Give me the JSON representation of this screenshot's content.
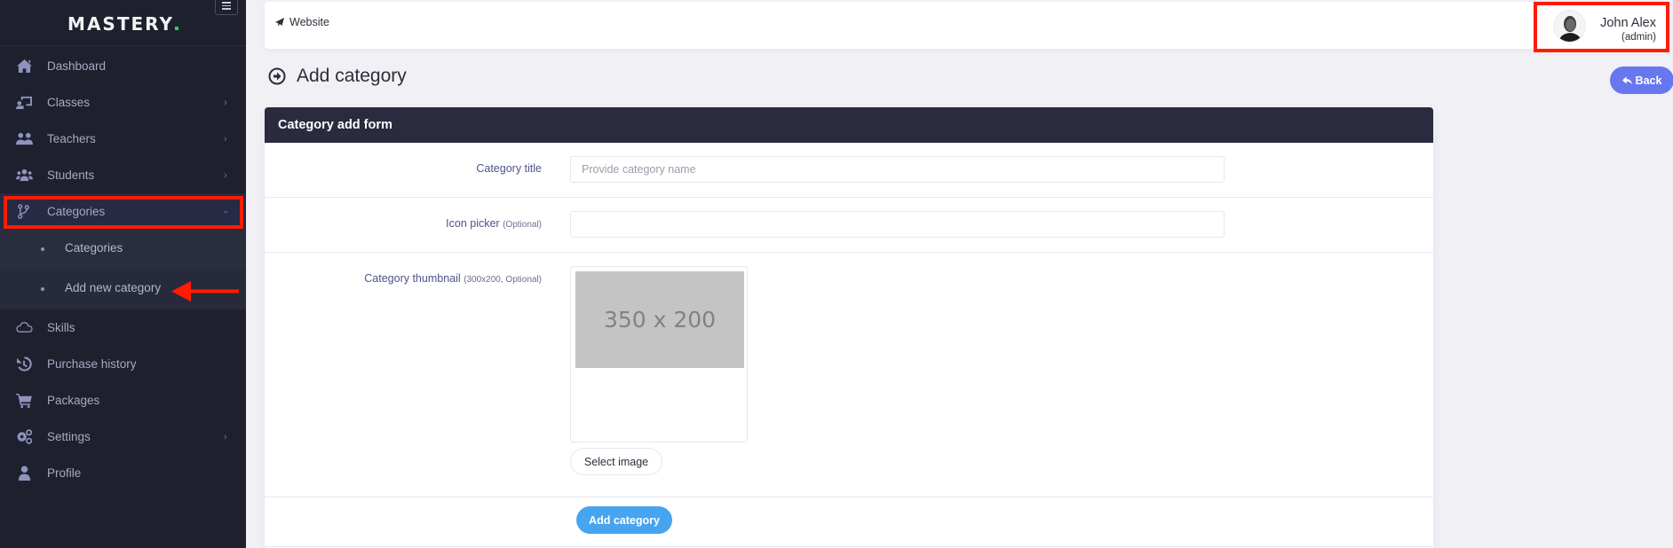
{
  "app": {
    "brand": "MASTERY",
    "brand_accent": "#22d36b"
  },
  "sidebar": {
    "items": [
      {
        "label": "Dashboard",
        "icon": "home-icon",
        "has_children": false
      },
      {
        "label": "Classes",
        "icon": "chalkboard-teacher-icon",
        "has_children": true
      },
      {
        "label": "Teachers",
        "icon": "users-icon",
        "has_children": true
      },
      {
        "label": "Students",
        "icon": "user-group-icon",
        "has_children": true
      },
      {
        "label": "Categories",
        "icon": "code-branch-icon",
        "has_children": true,
        "expanded": true,
        "active": true,
        "children": [
          {
            "label": "Categories"
          },
          {
            "label": "Add new category",
            "current": true
          }
        ]
      },
      {
        "label": "Skills",
        "icon": "cloud-icon",
        "has_children": false
      },
      {
        "label": "Purchase history",
        "icon": "history-icon",
        "has_children": false
      },
      {
        "label": "Packages",
        "icon": "shopping-cart-icon",
        "has_children": false
      },
      {
        "label": "Settings",
        "icon": "cogs-icon",
        "has_children": true
      },
      {
        "label": "Profile",
        "icon": "user-icon",
        "has_children": false
      }
    ]
  },
  "topbar": {
    "website_label": "Website",
    "user": {
      "name": "John Alex",
      "role": "(admin)"
    }
  },
  "page": {
    "title": "Add category",
    "back_label": "Back"
  },
  "form": {
    "header": "Category add form",
    "fields": {
      "title": {
        "label": "Category title",
        "placeholder": "Provide category name",
        "value": ""
      },
      "icon": {
        "label": "Icon picker",
        "hint": "(Optional)",
        "value": ""
      },
      "thumbnail": {
        "label": "Category thumbnail",
        "hint": "(300x200, Optional)",
        "placeholder_text": "350 x 200",
        "select_label": "Select image"
      }
    },
    "submit_label": "Add category"
  },
  "colors": {
    "sidebar_bg": "#1f202d",
    "card_header_bg": "#2a2b3e",
    "primary": "#6777ef",
    "submit": "#47a4f0",
    "annotation": "#ff1c00"
  }
}
